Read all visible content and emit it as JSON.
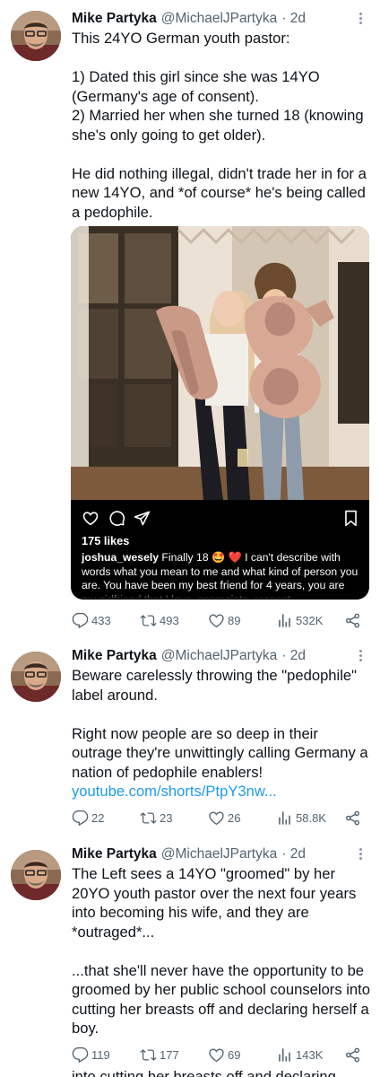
{
  "tweets": [
    {
      "name": "Mike Partyka",
      "handle": "@MichaelJPartyka",
      "time": "· 2d",
      "text": "This 24YO German youth pastor:\n\n1) Dated this girl since she was 14YO (Germany's age of consent).\n2) Married her when she turned 18 (knowing she's only going to get older).\n\nHe did nothing illegal, didn't trade her in for a new 14YO, and *of course* he's being called a pedophile.",
      "media": {
        "likes": "175 likes",
        "caption_user": "joshua_wesely",
        "caption_text": " Finally 18 🤩 ❤️  I can't describe with words what you mean to me and what kind of person you are. You have been my best friend for 4 years, you are my girlfriend that I love, appreciate, respect",
        "balloon_text": "18"
      },
      "replies": "433",
      "retweets": "493",
      "likes": "89",
      "views": "532K"
    },
    {
      "name": "Mike Partyka",
      "handle": "@MichaelJPartyka",
      "time": "· 2d",
      "text": "Beware carelessly throwing the \"pedophile\" label around.\n\nRight now people are so deep in their outrage they're unwittingly calling Germany a nation of pedophile enablers! ",
      "link": "youtube.com/shorts/PtpY3nw...",
      "replies": "22",
      "retweets": "23",
      "likes": "26",
      "views": "58.8K"
    },
    {
      "name": "Mike Partyka",
      "handle": "@MichaelJPartyka",
      "time": "· 2d",
      "text": "The Left sees a 14YO \"groomed\" by her 20YO youth pastor over the next four years into becoming his wife, and they are *outraged*...\n\n...that she'll never have the opportunity to be groomed by her public school counselors into cutting her breasts off and declaring herself a boy.",
      "replies": "119",
      "retweets": "177",
      "likes": "69",
      "views": "143K"
    }
  ],
  "peek_text": "into cutting her breasts off and declaring",
  "colors": {
    "text": "#0f1419",
    "secondary": "#536471",
    "link": "#1d9bf0",
    "background": "#ffffff"
  }
}
